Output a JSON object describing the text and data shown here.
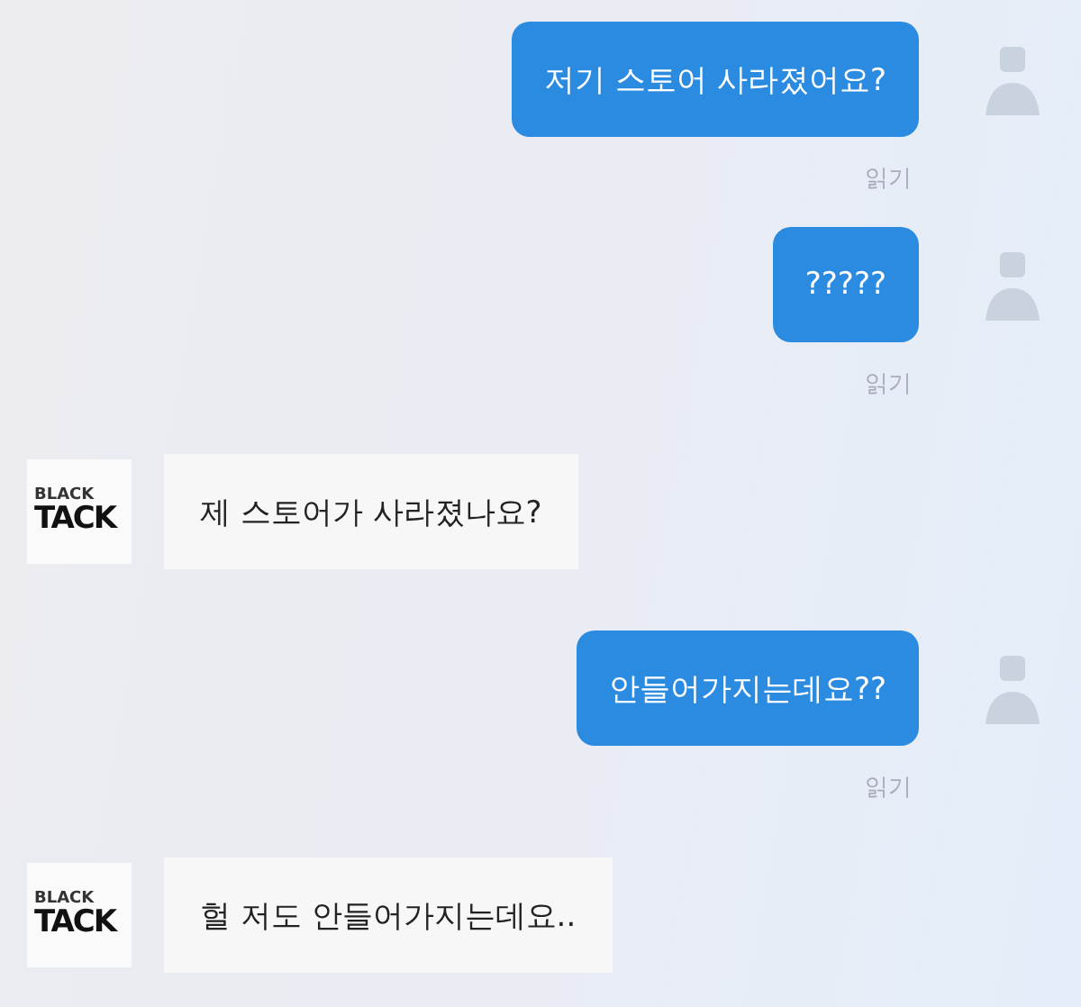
{
  "messages": [
    {
      "kind": "sent",
      "text": "저기 스토어 사라졌어요?",
      "receipt": "읽기"
    },
    {
      "kind": "sent",
      "text": "?????",
      "receipt": "읽기"
    },
    {
      "kind": "received",
      "text": "제 스토어가 사라졌나요?",
      "logo": [
        "BLACK",
        "TACK"
      ]
    },
    {
      "kind": "sent",
      "text": "안들어가지는데요??",
      "receipt": "읽기"
    },
    {
      "kind": "received",
      "text": "헐 저도 안들어가지는데요..",
      "logo": [
        "BLACK",
        "TACK"
      ]
    }
  ]
}
